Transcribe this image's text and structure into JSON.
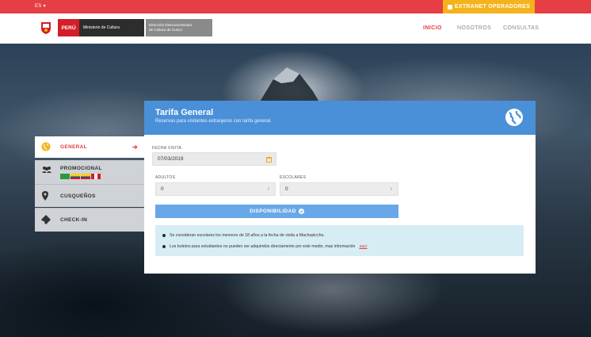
{
  "topbar": {
    "lang": "ES ▾",
    "extranet": "EXTRANET OPERADORES"
  },
  "header": {
    "peru": "PERÚ",
    "ministerio": "Ministerio de Cultura",
    "direccion_line1": "Dirección Desconcentrada",
    "direccion_line2": "de Cultura de Cusco",
    "nav": {
      "inicio": "INICIO",
      "nosotros": "NOSOTROS",
      "consultas": "CONSULTAS"
    }
  },
  "sidebar": {
    "items": [
      {
        "label": "GENERAL",
        "icon": "globe-icon",
        "active": true
      },
      {
        "label": "PROMOCIONAL",
        "icon": "group-icon",
        "active": false
      },
      {
        "label": "CUSQUEÑOS",
        "icon": "map-marker-icon",
        "active": false
      },
      {
        "label": "CHECK-IN",
        "icon": "ticket-icon",
        "active": false
      }
    ]
  },
  "card": {
    "title": "Tarifa General",
    "subtitle": "Reservas para visitantes extranjeros con tarifa general.",
    "fecha_label": "FECHA VISITA",
    "fecha_value": "07/03/2019",
    "adultos_label": "ADULTOS",
    "adultos_value": "0",
    "escolares_label": "ESCOLARES",
    "escolares_value": "0",
    "button": "DISPONIBILIDAD",
    "info": [
      "Se consideran escolares los menores de 18 años a la fecha de visita a Machupicchu.",
      "Los boletos para estudiantes no pueden ser adquiridos directamente por este medio, mas información"
    ],
    "info_link": "aquí"
  },
  "colors": {
    "accent_red": "#e53e45",
    "blue": "#4a90d9",
    "yellow": "#f5b21a"
  }
}
